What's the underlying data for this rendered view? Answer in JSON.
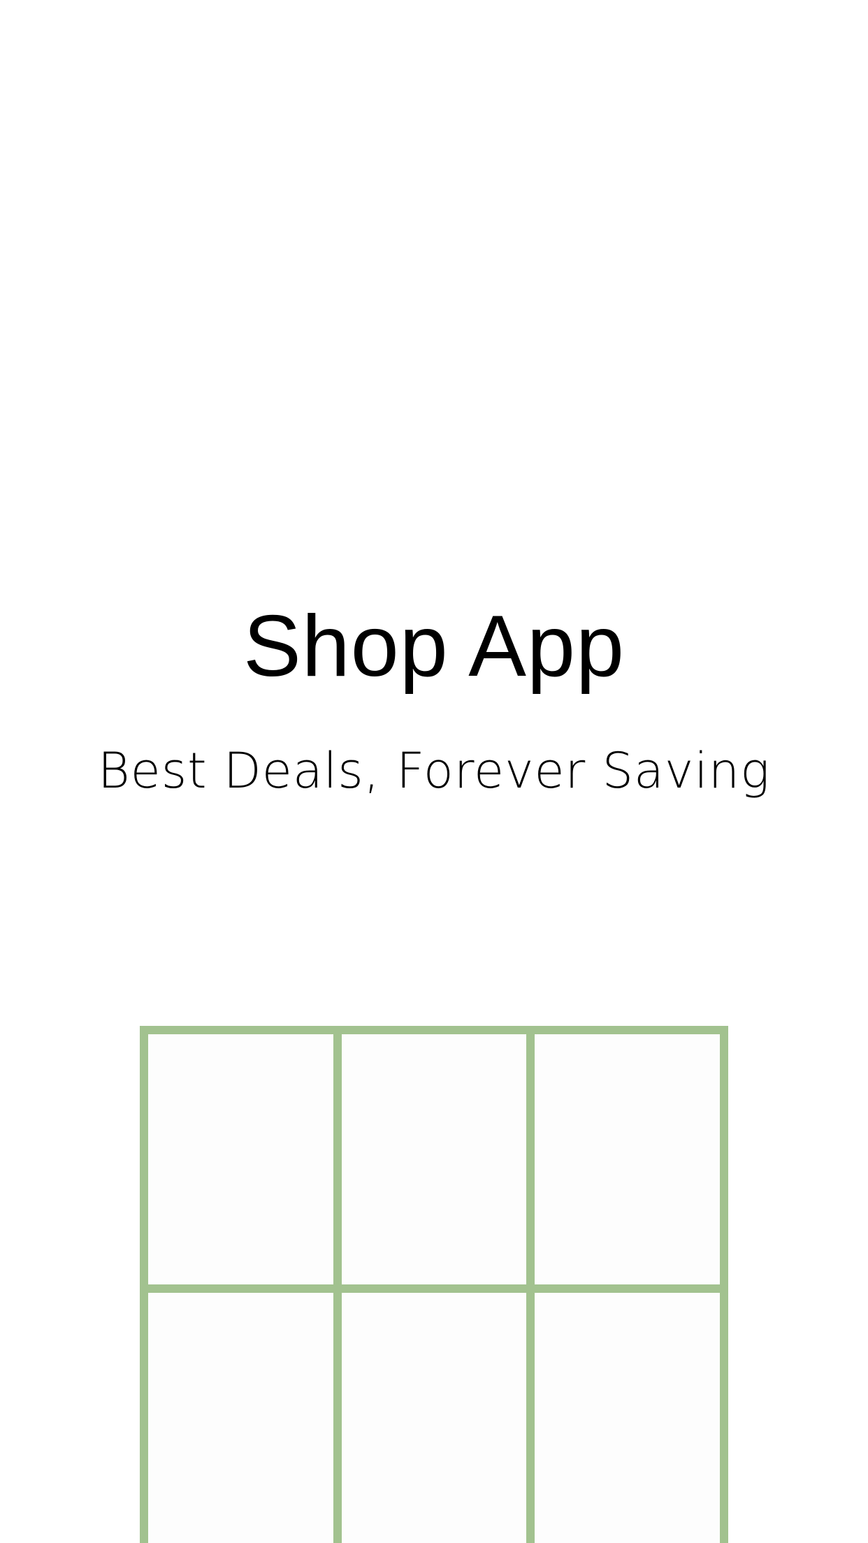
{
  "app": {
    "title": "Shop App",
    "tagline": "Best Deals, Forever Saving"
  },
  "colors": {
    "background": "#ffffff",
    "text": "#000000",
    "grid_border": "#a2c28f",
    "grid_cell": "#fdfdfd"
  },
  "grid": {
    "columns": 3,
    "rows_visible": 2
  }
}
